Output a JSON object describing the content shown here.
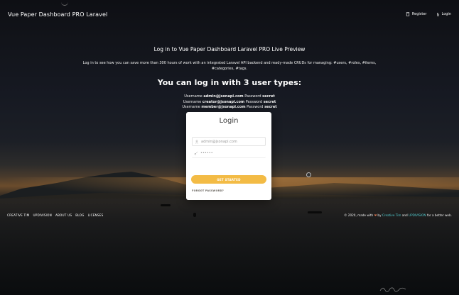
{
  "navbar": {
    "brand": "Vue Paper Dashboard PRO Laravel",
    "register_label": "Register",
    "login_label": "Login"
  },
  "header": {
    "title": "Log in to Vue Paper Dashboard Laravel PRO Live Preview",
    "description": "Log in to see how you can save more than 300 hours of work with an integrated Laravel API backend and ready-made CRUDs for managing: #users, #roles, #items, #categories, #tags.",
    "types_title": "You can log in with 3 user types:"
  },
  "credentials": [
    {
      "username_label": "Username",
      "username": "admin@jsonapi.com",
      "password_label": "Password",
      "password": "secret"
    },
    {
      "username_label": "Username",
      "username": "creator@jsonapi.com",
      "password_label": "Password",
      "password": "secret"
    },
    {
      "username_label": "Username",
      "username": "member@jsonapi.com",
      "password_label": "Password",
      "password": "secret"
    }
  ],
  "login_card": {
    "title": "Login",
    "email_value": "admin@jsonapi.com",
    "password_value": "••••••",
    "submit_label": "GET STARTED",
    "forgot_label": "FORGOT PASSWORD?"
  },
  "footer": {
    "links": [
      "CREATIVE TIM",
      "UPDIVISION",
      "ABOUT US",
      "BLOG",
      "LICENSES"
    ],
    "copyright_prefix": "© 2020, made with",
    "heart": "❤",
    "by": "by",
    "creative_tim": "Creative Tim",
    "and": "and",
    "updivision": "UPDIVISION",
    "suffix": "for a better web."
  },
  "colors": {
    "accent_warning": "#f3bb45",
    "link_teal": "#51cbce",
    "heart": "#ef8157"
  }
}
